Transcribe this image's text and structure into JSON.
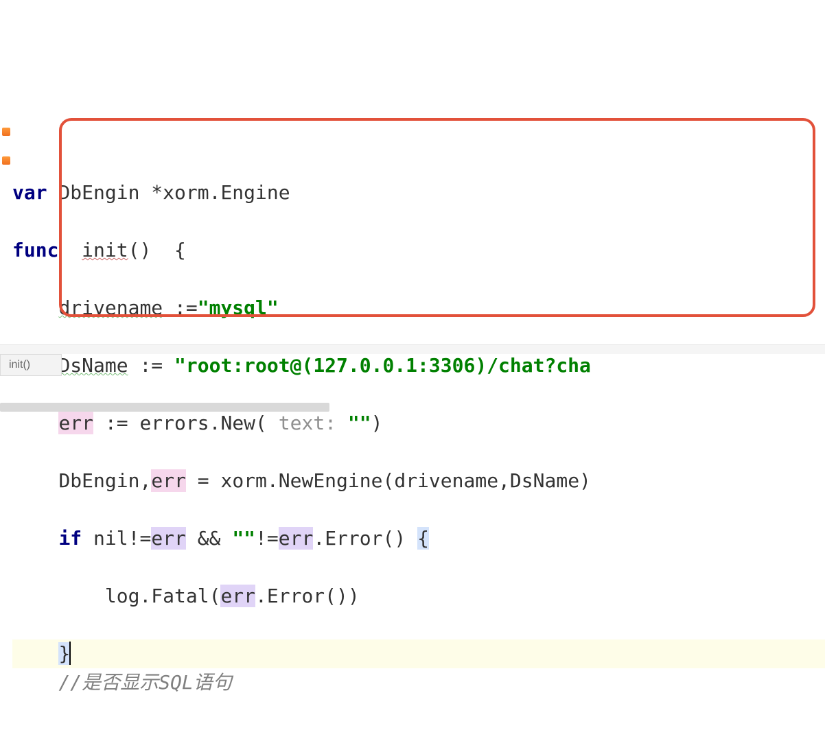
{
  "code": {
    "line1": {
      "kw_var": "var",
      "id1": " DbEngin *xorm.Engine"
    },
    "line2": {
      "kw_func": "func",
      "pad": "  ",
      "name": "init",
      "parens": "()",
      "pad2": "  ",
      "brace": "{"
    },
    "line3": {
      "indent": "    ",
      "lhs": "drivename",
      "assign": " :=",
      "str": "\"mysql\""
    },
    "line4": {
      "indent": "    ",
      "lhs": "DsName",
      "assign": " := ",
      "str": "\"root:root@(127.0.0.1:3306)/chat?cha"
    },
    "line5": {
      "indent": "    ",
      "err": "err",
      "assign": " := ",
      "call": "errors.New( ",
      "hint": "text: ",
      "strq": "\"\"",
      "close": ")"
    },
    "line6": {
      "indent": "    ",
      "lhs1": "DbEngin",
      "comma": ",",
      "err": "err",
      "eq": " = ",
      "rhs": "xorm.NewEngine(drivename,DsName)"
    },
    "line7": {
      "indent": "    ",
      "kw_if": "if",
      "nil": " nil!=",
      "err": "err",
      "andq": " && ",
      "qq": "\"\"",
      "ne": "!=",
      "err2": "err",
      "dot": ".Error() ",
      "brace": "{"
    },
    "line8": {
      "indent": "        ",
      "call1": "log.Fatal(",
      "err": "err",
      "call2": ".Error())"
    },
    "line9": {
      "indent": "    ",
      "brace": "}"
    },
    "line10": {
      "indent": "    ",
      "comment": "//是否显示SQL语句"
    }
  },
  "breadcrumb": "init()"
}
